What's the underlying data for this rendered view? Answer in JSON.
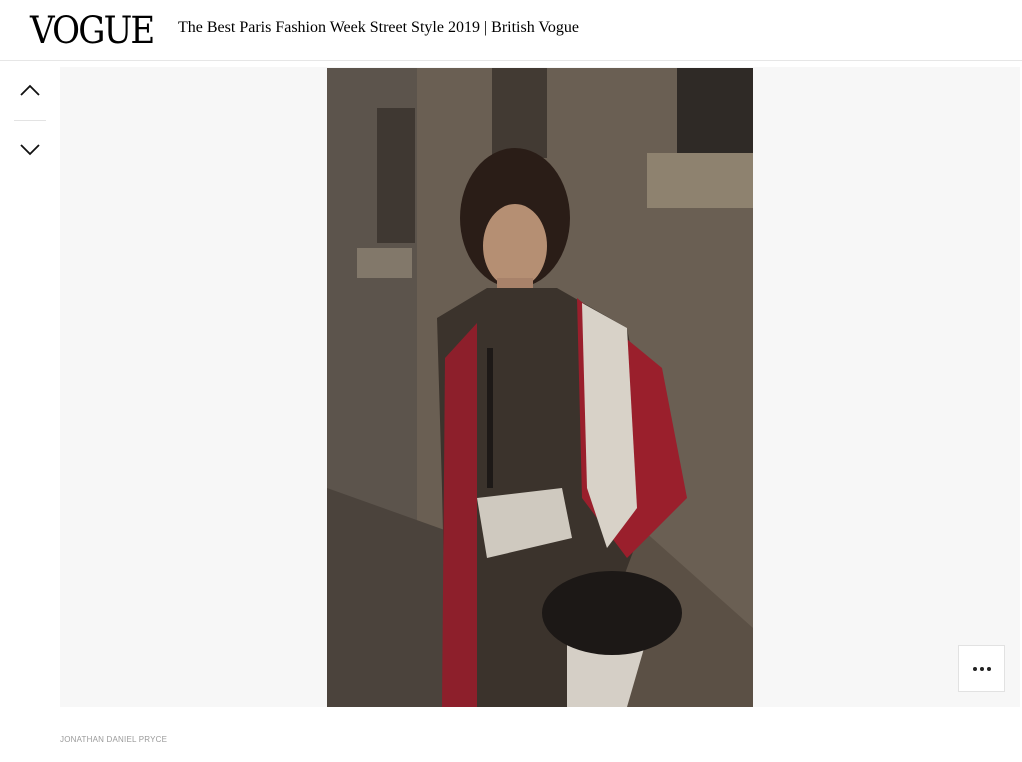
{
  "header": {
    "logo_text": "VOGUE",
    "title": "The Best Paris Fashion Week Street Style 2019 | British Vogue"
  },
  "nav": {
    "up_icon": "chevron-up-icon",
    "down_icon": "chevron-down-icon"
  },
  "gallery": {
    "image_description": "street style photo",
    "more_icon": "more-horizontal-icon",
    "credit": "JONATHAN DANIEL PRYCE"
  },
  "colors": {
    "header_border": "#e6e6e6",
    "stage_background": "#f7f7f7",
    "credit_text": "#9a9a9a"
  }
}
